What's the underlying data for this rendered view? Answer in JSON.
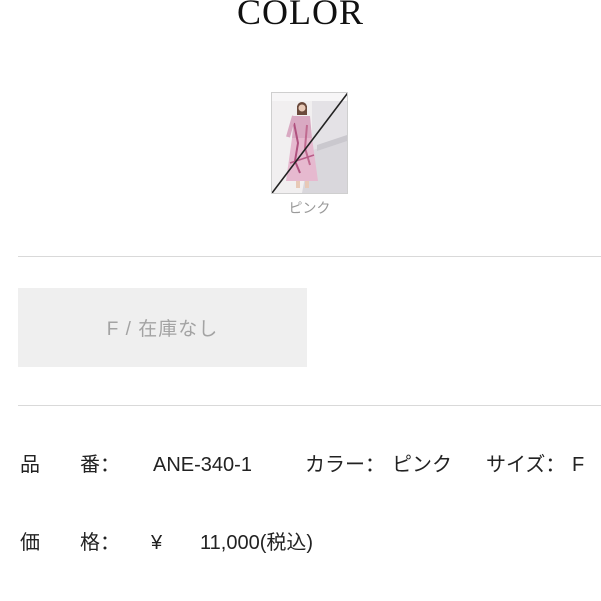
{
  "heading": "COLOR",
  "color_options": [
    {
      "label": "ピンク",
      "available": false
    }
  ],
  "size_option": {
    "label": "F / 在庫なし"
  },
  "details": {
    "product_number_label": "品　　番：",
    "product_number_value": "ANE-340-1",
    "color_label": "カラー：",
    "color_value": "ピンク",
    "size_label": "サイズ：",
    "size_value": "F",
    "price_label": "価　　格：",
    "price_currency": "¥",
    "price_value": "11,000(税込)"
  }
}
